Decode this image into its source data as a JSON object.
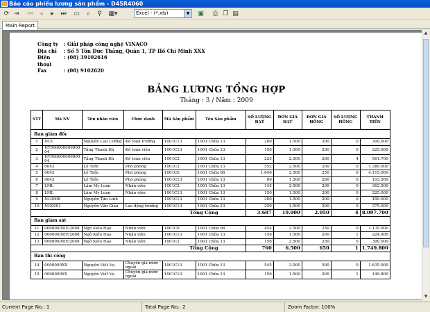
{
  "window": {
    "title": "Báo cáo phiếu lương sản phẩm - D45R4060"
  },
  "toolbar": {
    "buttons": [
      {
        "icon": "refresh-icon",
        "x": "refresh-button"
      },
      {
        "icon": "export-icon"
      }
    ],
    "export_format": "Excel - (*.xls)"
  },
  "tabs": [
    {
      "label": "Main Report"
    }
  ],
  "report": {
    "company_rows": [
      {
        "label": "Công ty",
        "value": ": Giải pháp công nghệ VINACO"
      },
      {
        "label": "Địa chỉ",
        "value": ": Số 5 Tôn Đức Thắng, Quận 1, TP Hồ Chí Minh XXX"
      },
      {
        "label": "Điện thoại",
        "value": ": (08) 39102616"
      },
      {
        "label": "Fax",
        "value": ": (08) 9102620"
      }
    ],
    "title": "BẢNG LƯƠNG TỔNG HỢP",
    "period": "Tháng : 3 / Năm : 2009",
    "columns": [
      "STT",
      "Mã NV",
      "Tên nhân viên",
      "Chức danh",
      "Mã Sản phẩm",
      "Tên Sản phẩm",
      "SỐ LƯỢNG ĐẠT",
      "ĐƠN GIÁ ĐẠT",
      "ĐƠN GIÁ HỎNG",
      "SỐ LƯỢNG HỎNG",
      "THÀNH TIỀN"
    ],
    "groups": [
      {
        "name": "Ban giám đốc",
        "rows": [
          [
            "1",
            "NCC",
            "Nguyễn Cao Cường",
            "Kế toán trưởng",
            "1001C13",
            "1001 Chữa 13",
            "200",
            "1.500",
            "200",
            "0",
            "300.000"
          ],
          [
            "2",
            "HT000000000000 04",
            "Tăng Thanh Hà",
            "Kế toán viên",
            "1001C13",
            "1001 Chữa 13",
            "150",
            "1.500",
            "200",
            "0",
            "225.000"
          ],
          [
            "3",
            "HT000000000000 04",
            "Tăng Thanh Hà",
            "Kế toán viên",
            "1001C2",
            "1001 Chữa 13",
            "225",
            "2.500",
            "200",
            "4",
            "561.700"
          ],
          [
            "4",
            "0043",
            "Lê Tiến",
            "Phó phòng",
            "1001C2",
            "1001 Chữa 13",
            "552",
            "2.500",
            "200",
            "0",
            "1.380.000"
          ],
          [
            "5",
            "0043",
            "Lê Tiến",
            "Phó phòng",
            "1001C6",
            "1001 Chữa 06",
            "1.646",
            "2.500",
            "250",
            "0",
            "4.115.000"
          ],
          [
            "6",
            "0043",
            "Lê Tiến",
            "Phó phòng",
            "1001C13",
            "1001 Chữa 13",
            "69",
            "1.500",
            "200",
            "0",
            "103.500"
          ],
          [
            "7",
            "LML",
            "Lâm Mỹ Loan",
            "Nhân viên",
            "1001C2",
            "1001 Chữa 13",
            "145",
            "2.500",
            "200",
            "0",
            "362.500"
          ],
          [
            "8",
            "LML",
            "Lâm Mỹ Loan",
            "Nhân viên",
            "1001C13",
            "1001 Chữa 13",
            "150",
            "1.500",
            "200",
            "0",
            "225.000"
          ],
          [
            "9",
            "NL0008",
            "Nguyễn Tấn Linh",
            "",
            "1001C13",
            "1001 Chữa 13",
            "300",
            "1.500",
            "200",
            "0",
            "450.000"
          ],
          [
            "10",
            "NG0001",
            "Nguyễn Văn Giàu",
            "Lao động trưởng",
            "1001C13",
            "1001 Chữa 13",
            "250",
            "1.500",
            "200",
            "0",
            "375.000"
          ]
        ],
        "total": {
          "label": "Tổng Cộng",
          "qty": "3.687",
          "price": "19.000",
          "bad_price": "2.050",
          "bad_qty": "4",
          "amount": "8.097.700"
        }
      },
      {
        "name": "Ban giám sát",
        "rows": [
          [
            "11",
            "000000/NIV/2008",
            "Ngô Kiều Hạo",
            "Nhân viên",
            "1001C6",
            "1001 Chữa 06",
            "454",
            "2.500",
            "250",
            "0",
            "1.135.000"
          ],
          [
            "12",
            "000000/NIV/2008",
            "Ngô Kiều Hạo",
            "Nhân viên",
            "1001C13",
            "1001 Chữa 13",
            "150",
            "1.500",
            "200",
            "1",
            "224.800"
          ],
          [
            "13",
            "000000/NIV/2008",
            "Ngô Kiều Hạo",
            "Nhân viên",
            "1001C2",
            "1001 Chữa 13",
            "156",
            "2.500",
            "200",
            "0",
            "390.000"
          ]
        ],
        "total": {
          "label": "Tổng Cộng",
          "qty": "760",
          "price": "6.500",
          "bad_price": "650",
          "bad_qty": "1",
          "amount": "1.749.800"
        }
      },
      {
        "name": "Ban thi công",
        "rows": [
          [
            "14",
            "0000000XX",
            "Nguyễn Viết Vụ",
            "Chuyên gia nước ngoài",
            "1001C13",
            "1001 Chữa 13",
            "545",
            "3.000",
            "500",
            "0",
            "1.635.000"
          ],
          [
            "15",
            "0000000XX",
            "Nguyễn Viết Vụ",
            "Chuyên gia nước ngoài",
            "1001C13",
            "1001 Chữa 13",
            "150",
            "1.500",
            "200",
            "1",
            "149.800"
          ]
        ]
      }
    ]
  },
  "status": {
    "current_page": "Current Page No.: 1",
    "total_page": "Total Page No.: 2",
    "zoom": "Zoom Factor: 100%"
  }
}
